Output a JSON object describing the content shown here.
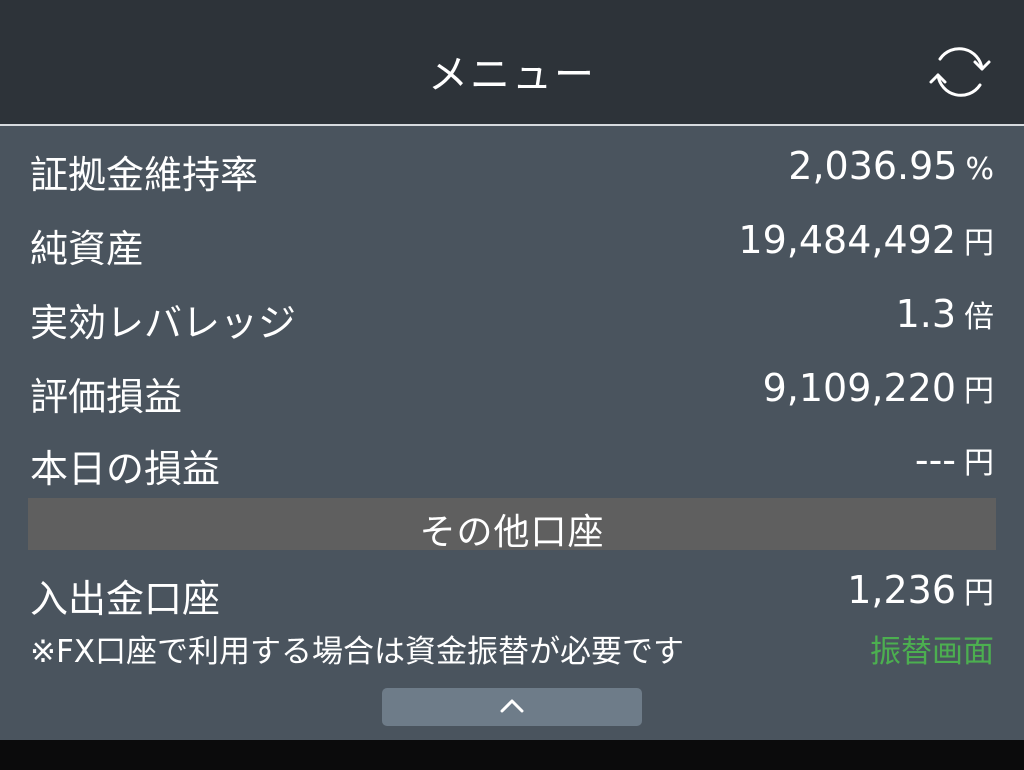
{
  "header": {
    "title": "メニュー",
    "refresh_icon": "refresh-icon"
  },
  "account_summary": [
    {
      "label": "証拠金維持率",
      "value": "2,036.95",
      "unit": "%"
    },
    {
      "label": "純資産",
      "value": "19,484,492",
      "unit": "円"
    },
    {
      "label": "実効レバレッジ",
      "value": "1.3",
      "unit": "倍"
    },
    {
      "label": "評価損益",
      "value": "9,109,220",
      "unit": "円"
    },
    {
      "label": "本日の損益",
      "value": "---",
      "unit": "円"
    }
  ],
  "other_accounts": {
    "section_title": "その他口座",
    "deposit_account": {
      "label": "入出金口座",
      "value": "1,236",
      "unit": "円"
    },
    "note": "※FX口座で利用する場合は資金振替が必要です",
    "transfer_link": "振替画面",
    "transfer_link_color": "#4caf50"
  },
  "collapse": {
    "icon": "chevron-up-icon"
  },
  "colors": {
    "header_bg": "#2d3339",
    "panel_bg": "#4a545e",
    "section_bar_bg": "#5f5f5f",
    "collapse_button_bg": "#6e7c89"
  }
}
